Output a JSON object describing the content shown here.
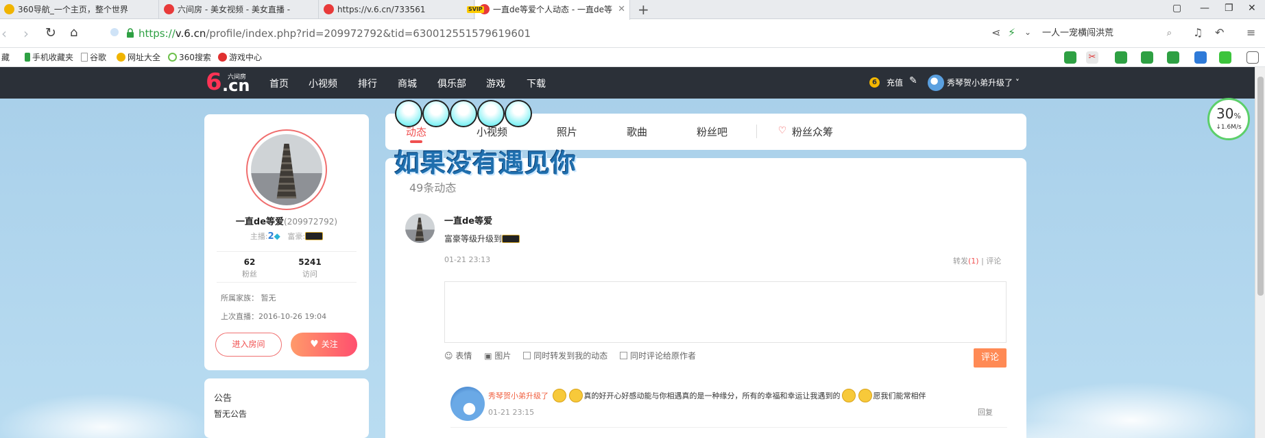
{
  "browser": {
    "tabs": [
      {
        "title": "360导航_一个主页，整个世界",
        "color": "#f0b400"
      },
      {
        "title": "六间房 - 美女视频 - 美女直播 - ",
        "color": "#e83a3a"
      },
      {
        "title": "https://v.6.cn/733561",
        "color": "#e83a3a"
      },
      {
        "title": "一直de等爱个人动态 - 一直de等",
        "color": "#e83a3a"
      }
    ],
    "new_tab": "+",
    "url_proto": "https://",
    "url_host": "v.6.cn",
    "url_rest": "/profile/index.php?rid=209972792&tid=630012551579619601",
    "search_text": "一人一宠横闯洪荒",
    "bookmarks": [
      "藏",
      "手机收藏夹",
      "谷歌",
      "网址大全",
      "360搜索",
      "游戏中心"
    ]
  },
  "site": {
    "logo_six": "6",
    "logo_cn": ".cn",
    "logo_brand": "六间房",
    "menu": [
      "首页",
      "小视频",
      "排行",
      "商城",
      "俱乐部",
      "游戏",
      "下载"
    ],
    "svip": "SVIP",
    "recharge": "充值",
    "user": "秀琴贺小弟升级了"
  },
  "profile": {
    "name": "一直de等爱",
    "rid": "(209972792)",
    "host_label": "主播:",
    "host_level": "2",
    "rich_label": "富豪:",
    "fans_count": "62",
    "fans_label": "粉丝",
    "visits_count": "5241",
    "visits_label": "访问",
    "family": "所属家族：  暂无",
    "last_live": "上次直播：2016-10-26 19:04",
    "enter_room": "进入房间",
    "follow": "关注"
  },
  "notice": {
    "title": "公告",
    "text": "暂无公告"
  },
  "tabs": [
    "动态",
    "小视频",
    "照片",
    "歌曲",
    "粉丝吧",
    "粉丝众筹"
  ],
  "overlay_title": "如果没有遇见你",
  "feed": {
    "count": "49条动态",
    "post": {
      "author": "一直de等爱",
      "text": "富豪等级升级到",
      "time": "01-21 23:13",
      "forward": "转发",
      "forward_count": "(1)",
      "sep": "|",
      "comment": "评论"
    },
    "tools": {
      "emoji": "表情",
      "image": "图片",
      "sync_forward": "同时转发到我的动态",
      "sync_comment": "同时评论给原作者",
      "submit": "评论"
    },
    "reply": {
      "user": "秀琴贺小弟升级了",
      "text_a": "真的好开心好感动能与你相遇真的是一种缘分，所有的幸福和幸运让我遇到的",
      "text_b": "愿我们能常相伴",
      "time": "01-21 23:15",
      "reply_label": "回复"
    }
  },
  "speed": {
    "percent": "30",
    "unit": "%",
    "rate": "1.6M/s"
  }
}
